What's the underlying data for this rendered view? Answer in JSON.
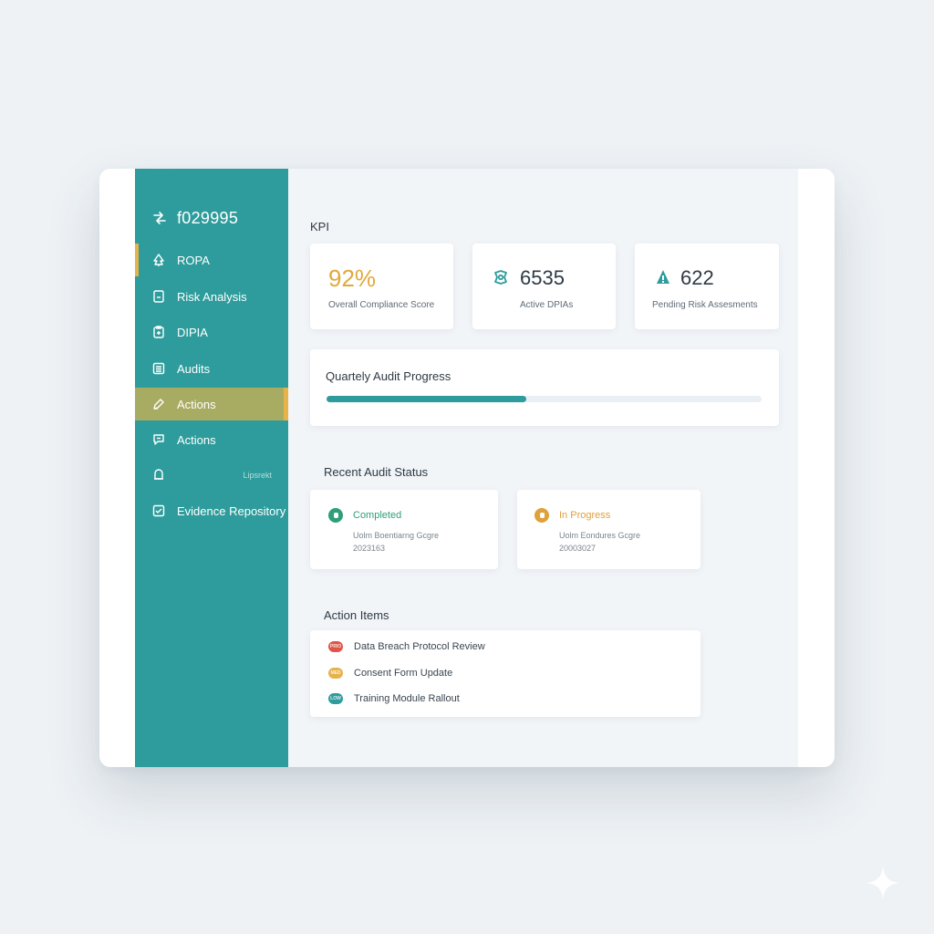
{
  "sidebar": {
    "brand": "f029995",
    "items": [
      {
        "label": "ROPA",
        "icon": "tree-icon"
      },
      {
        "label": "Risk Analysis",
        "icon": "document-icon"
      },
      {
        "label": "DIPIA",
        "icon": "clipboard-icon"
      },
      {
        "label": "Audits",
        "icon": "list-icon"
      },
      {
        "label": "Actions",
        "icon": "pen-icon"
      },
      {
        "label": "Actions",
        "icon": "chat-icon"
      },
      {
        "label": "",
        "icon": "bell-icon",
        "small_text": "Lipsrekt"
      },
      {
        "label": "Evidence Repository",
        "icon": "checkbox-icon"
      }
    ],
    "active_index": 4
  },
  "kpi": {
    "title": "KPI",
    "cards": [
      {
        "value": "92%",
        "label": "Overall Compliance Score",
        "value_color": "#e0a93b"
      },
      {
        "value": "6535",
        "label": "Active DPIAs",
        "icon": "shield-gear-icon"
      },
      {
        "value": "622",
        "label": "Pending Risk Assesments",
        "icon": "warning-icon"
      }
    ]
  },
  "audit_progress": {
    "title": "Quartely Audit Progress",
    "progress": 0.46
  },
  "recent_audit": {
    "title": "Recent Audit Status",
    "items": [
      {
        "status": "Completed",
        "color": "#2e9f77",
        "line1": "Uolm Boentiarng Gcgre",
        "line2": "2023163"
      },
      {
        "status": "In Progress",
        "color": "#e0a13a",
        "line1": "Uolm Eondures Gcgre",
        "line2": "20003027"
      }
    ]
  },
  "action_items": {
    "title": "Action Items",
    "items": [
      {
        "label": "Data Breach Protocol Review",
        "color": "#e05448",
        "tag": "PRIO"
      },
      {
        "label": "Consent Form Update",
        "color": "#e6b24a",
        "tag": "MED"
      },
      {
        "label": "Training Module Rallout",
        "color": "#2e9c9c",
        "tag": "LOW"
      }
    ]
  },
  "colors": {
    "sidebar": "#2e9c9c",
    "active_item": "#a8ac62",
    "accent": "#e6b24a"
  }
}
